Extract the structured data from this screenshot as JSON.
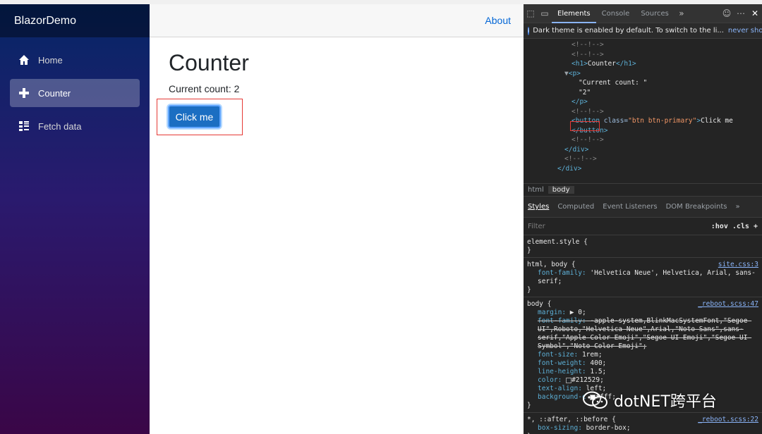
{
  "sidebar": {
    "brand": "BlazorDemo",
    "items": [
      {
        "label": "Home",
        "icon": "home-icon"
      },
      {
        "label": "Counter",
        "icon": "plus-icon",
        "active": true
      },
      {
        "label": "Fetch data",
        "icon": "list-icon"
      }
    ]
  },
  "topbar": {
    "about": "About"
  },
  "page": {
    "title": "Counter",
    "count_text": "Current count: 2",
    "button": "Click me"
  },
  "devtools": {
    "tabs": [
      "Elements",
      "Console",
      "Sources"
    ],
    "more": "»",
    "info_text": "Dark theme is enabled by default. To switch to the li...",
    "never_show": "never show",
    "dom": {
      "c1": "<!--!-->",
      "c2": "<!--!-->",
      "h1_open": "<h1>",
      "h1_text": "Counter",
      "h1_close": "</h1>",
      "p_open": "<p>",
      "p_text": "\"Current count: \"",
      "p_value": "\"2\"",
      "p_close": "</p>",
      "c3": "<!--!-->",
      "btn_open": "<button ",
      "btn_attr": "class=",
      "btn_class": "\"btn btn-primary\"",
      "btn_gt": ">",
      "btn_text": "Click me",
      "btn_close": "</button>",
      "c4": "<!--!-->",
      "div_close": "</div>",
      "c5": "<!--!-->",
      "div_close2": "</div>"
    },
    "crumbs": [
      "html",
      "body"
    ],
    "styles_tabs": [
      "Styles",
      "Computed",
      "Event Listeners",
      "DOM Breakpoints"
    ],
    "filter_placeholder": "Filter",
    "filter_tools": ":hov  .cls  +",
    "rules": {
      "element_style": "element.style {",
      "r1_selector": "html, body {",
      "r1_src": "site.css:3",
      "r1_prop": "font-family:",
      "r1_val": "'Helvetica Neue', Helvetica, Arial, sans-serif;",
      "r2_selector": "body {",
      "r2_src": "_reboot.scss:47",
      "margin_p": "margin:",
      "margin_v": "▶ 0;",
      "ff_p": "font-family:",
      "ff_v": "-apple-system,BlinkMacSystemFont,\"Segoe UI\",Roboto,\"Helvetica Neue\",Arial,\"Noto Sans\",sans-serif,\"Apple Color Emoji\",\"Segoe UI Emoji\",\"Segoe UI Symbol\",\"Noto Color Emoji\";",
      "fs_p": "font-size:",
      "fs_v": "1rem;",
      "fw_p": "font-weight:",
      "fw_v": "400;",
      "lh_p": "line-height:",
      "lh_v": "1.5;",
      "color_p": "color:",
      "color_v": "#212529;",
      "ta_p": "text-align:",
      "ta_v": "left;",
      "bg_p": "background-c",
      "bg_v": "#fff;",
      "r3_selector": "*, ::after, ::before {",
      "r3_src": "_reboot.scss:22",
      "bs_p": "box-sizing:",
      "bs_v": "border-box;",
      "close": "}"
    }
  },
  "watermark": "dotNET跨平台",
  "colors": {
    "accent": "#1b6ec2",
    "link": "#0366d6",
    "highlight": "#e53935"
  }
}
